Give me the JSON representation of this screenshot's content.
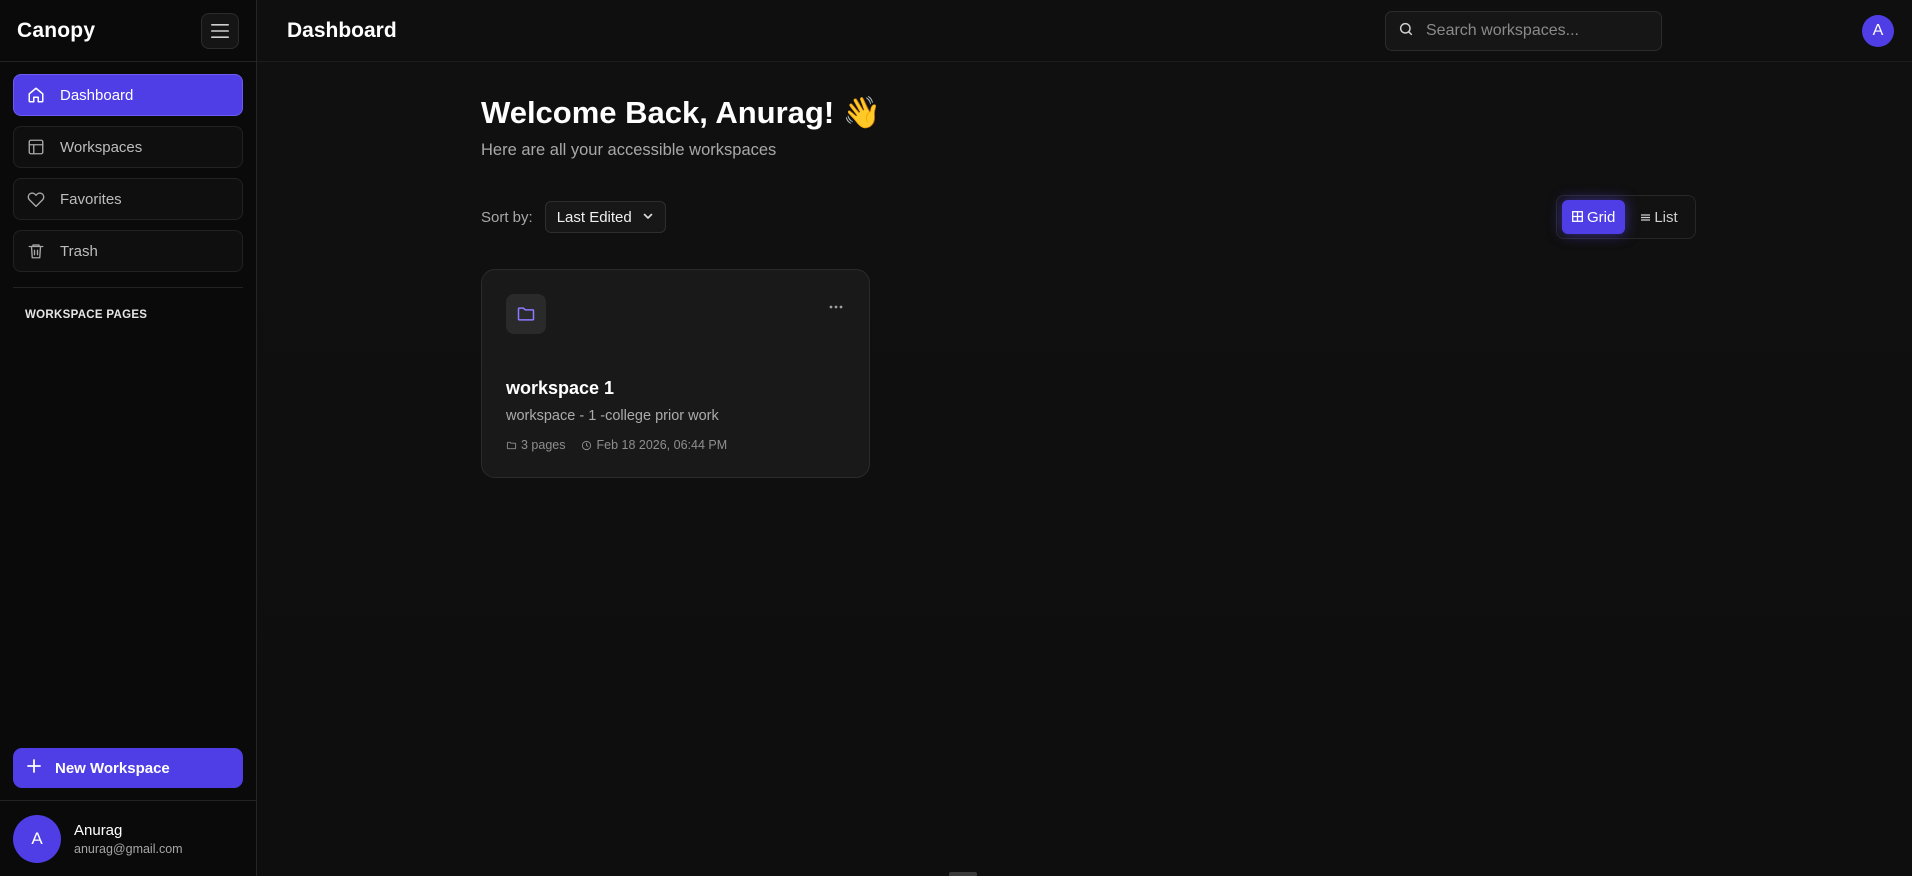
{
  "sidebar": {
    "brand": "Canopy",
    "nav": [
      {
        "label": "Dashboard",
        "icon": "home-icon",
        "active": true
      },
      {
        "label": "Workspaces",
        "icon": "layout-icon",
        "active": false
      },
      {
        "label": "Favorites",
        "icon": "heart-icon",
        "active": false
      },
      {
        "label": "Trash",
        "icon": "trash-icon",
        "active": false
      }
    ],
    "section_title": "WORKSPACE PAGES",
    "new_workspace_label": "New Workspace",
    "user": {
      "initial": "A",
      "name": "Anurag",
      "email": "anurag@gmail.com"
    }
  },
  "topbar": {
    "title": "Dashboard",
    "search_placeholder": "Search workspaces...",
    "avatar_initial": "A"
  },
  "main": {
    "welcome_title": "Welcome Back, Anurag! 👋",
    "welcome_subtitle": "Here are all your accessible workspaces",
    "sort_label": "Sort by:",
    "sort_value": "Last Edited",
    "view_grid_label": "Grid",
    "view_list_label": "List",
    "workspaces": [
      {
        "title": "workspace 1",
        "description": "workspace - 1 -college prior work",
        "pages": "3 pages",
        "edited": "Feb 18 2026, 06:44 PM"
      }
    ]
  },
  "colors": {
    "accent": "#4f3ee6",
    "background": "#0d0d0d"
  }
}
